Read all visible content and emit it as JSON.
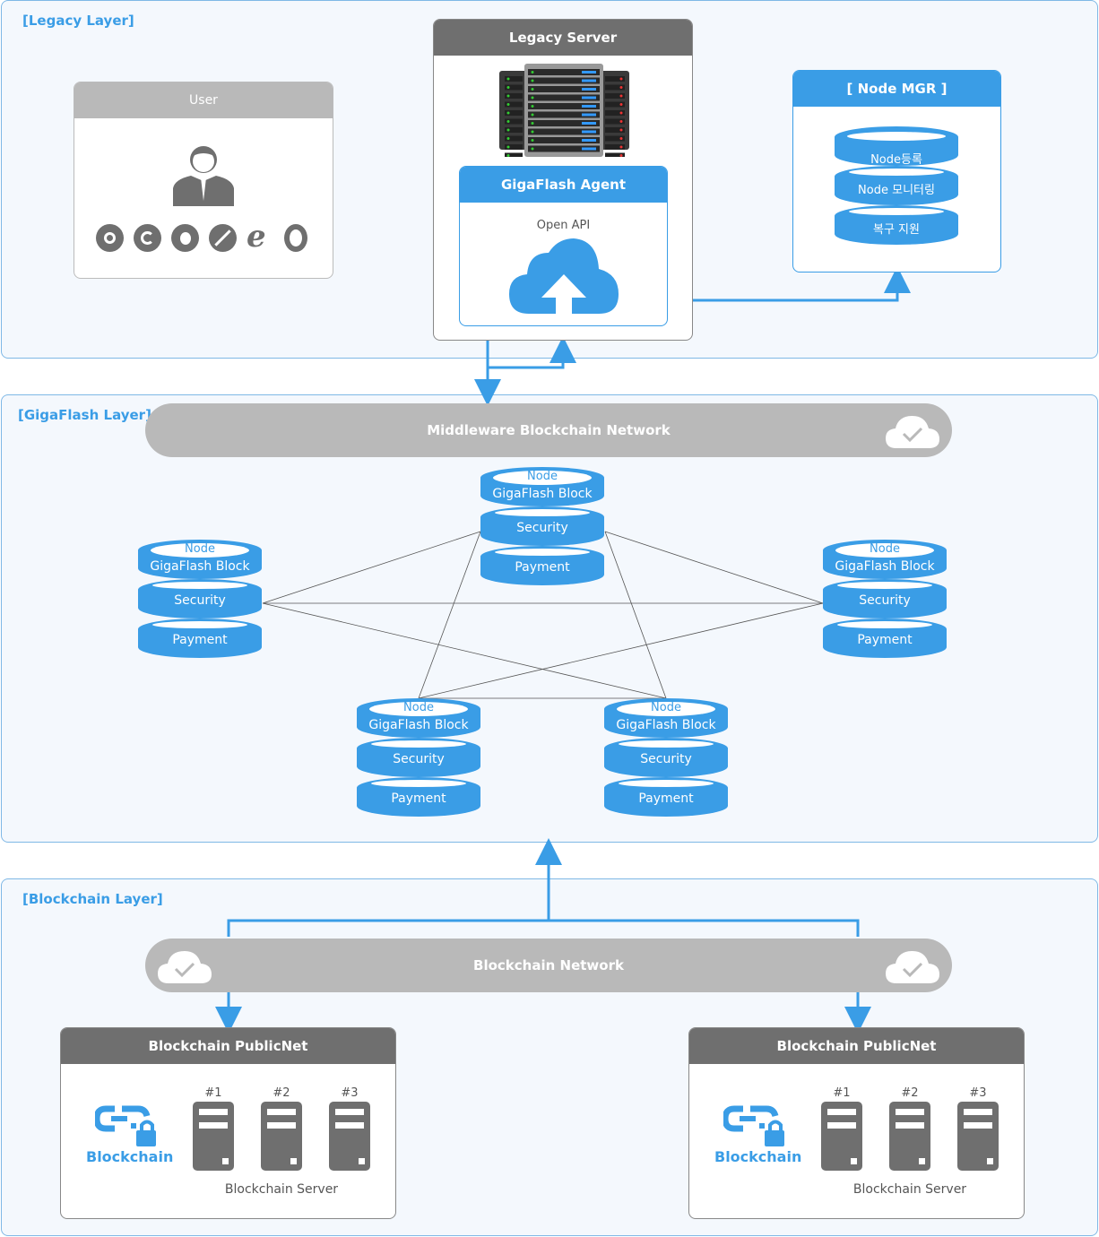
{
  "legacy_layer": {
    "title": "[Legacy Layer]",
    "user": {
      "title": "User",
      "browser_icons": [
        "chrome-icon",
        "edge-icon",
        "firefox-icon",
        "safari-icon",
        "ie-icon",
        "opera-icon"
      ]
    },
    "legacy_server": {
      "title": "Legacy Server",
      "agent": {
        "title": "GigaFlash Agent",
        "api": "Open API"
      }
    },
    "node_mgr": {
      "title": "[ Node MGR ]",
      "items": [
        "Node등록",
        "Node 모니터링",
        "복구 지원"
      ]
    }
  },
  "gigaflash_layer": {
    "title": "[GigaFlash Layer]",
    "network": "Middleware Blockchain Network",
    "node": {
      "tag": "Node",
      "segments": [
        "GigaFlash Block",
        "Security",
        "Payment"
      ]
    }
  },
  "blockchain_layer": {
    "title": "[Blockchain Layer]",
    "network": "Blockchain Network",
    "publicnets": [
      {
        "title": "Blockchain PublicNet",
        "logo_label": "Blockchain",
        "servers": [
          "#1",
          "#2",
          "#3"
        ],
        "caption": "Blockchain Server"
      },
      {
        "title": "Blockchain PublicNet",
        "logo_label": "Blockchain",
        "servers": [
          "#1",
          "#2",
          "#3"
        ],
        "caption": "Blockchain Server"
      }
    ]
  },
  "colors": {
    "accent": "#3a9de6",
    "header_gray": "#6f6f6f",
    "pill_gray": "#b9b9b9"
  }
}
